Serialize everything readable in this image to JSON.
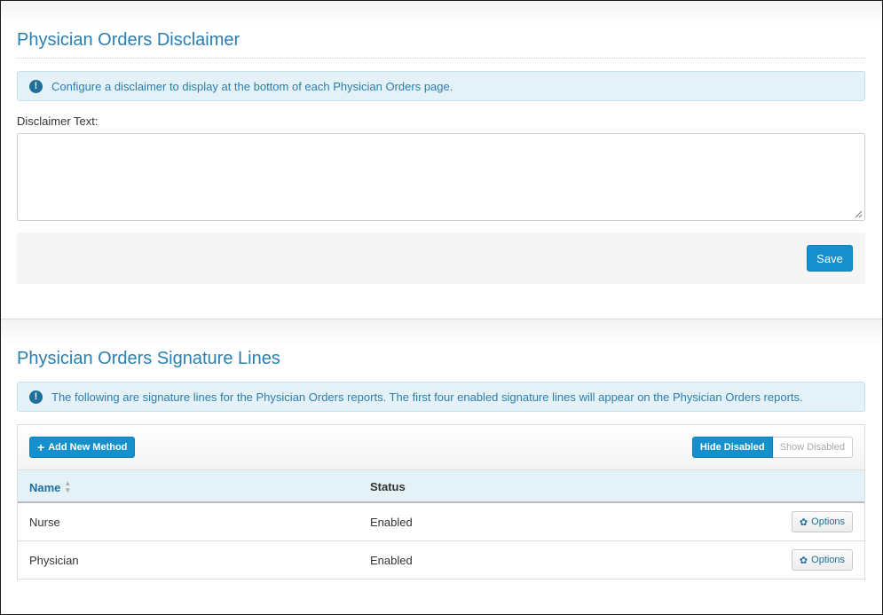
{
  "disclaimer": {
    "title": "Physician Orders Disclaimer",
    "info_text": "Configure a disclaimer to display at the bottom of each Physician Orders page.",
    "field_label": "Disclaimer Text:",
    "field_value": "",
    "save_label": "Save"
  },
  "signature_lines": {
    "title": "Physician Orders Signature Lines",
    "info_text": "The following are signature lines for the Physician Orders reports. The first four enabled signature lines will appear on the Physician Orders reports.",
    "add_button_label": "Add New Method",
    "hide_disabled_label": "Hide Disabled",
    "show_disabled_label": "Show Disabled",
    "columns": {
      "name": "Name",
      "status": "Status"
    },
    "rows": [
      {
        "name": "Nurse",
        "status": "Enabled",
        "options_label": "Options"
      },
      {
        "name": "Physician",
        "status": "Enabled",
        "options_label": "Options"
      }
    ]
  },
  "icons": {
    "info": "info-circle-icon",
    "plus": "plus-icon",
    "sort": "sort-icon",
    "gear": "gear-icon"
  },
  "colors": {
    "accent": "#1690cc",
    "title": "#2a7fb0",
    "alert_bg": "#e4f1f6"
  }
}
